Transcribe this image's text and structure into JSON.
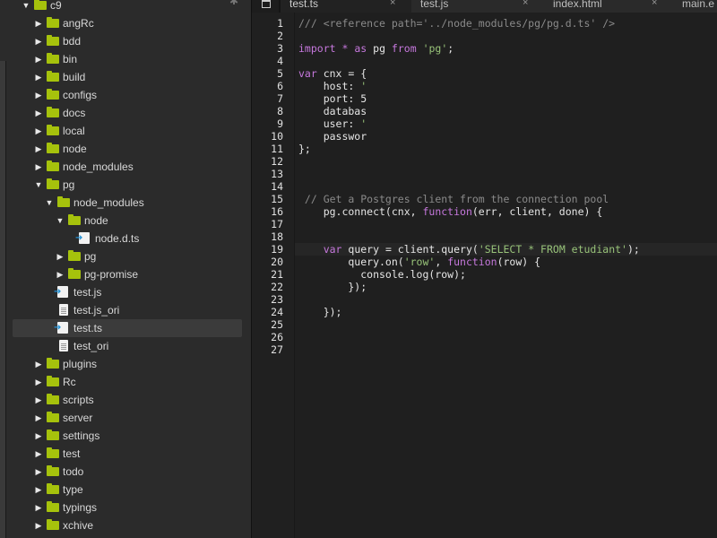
{
  "tree": {
    "root": {
      "label": "c9",
      "icon": "folder-icon"
    },
    "items": [
      {
        "label": "angRc"
      },
      {
        "label": "bdd"
      },
      {
        "label": "bin"
      },
      {
        "label": "build"
      },
      {
        "label": "configs"
      },
      {
        "label": "docs"
      },
      {
        "label": "local"
      },
      {
        "label": "node"
      },
      {
        "label": "node_modules"
      },
      {
        "label": "pg"
      },
      {
        "label": "node_modules"
      },
      {
        "label": "node"
      },
      {
        "label": "node.d.ts"
      },
      {
        "label": "pg"
      },
      {
        "label": "pg-promise"
      },
      {
        "label": "test.js"
      },
      {
        "label": "test.js_ori"
      },
      {
        "label": "test.ts"
      },
      {
        "label": "test_ori"
      },
      {
        "label": "plugins"
      },
      {
        "label": "Rc"
      },
      {
        "label": "scripts"
      },
      {
        "label": "server"
      },
      {
        "label": "settings"
      },
      {
        "label": "test"
      },
      {
        "label": "todo"
      },
      {
        "label": "type"
      },
      {
        "label": "typings"
      },
      {
        "label": "xchive"
      }
    ]
  },
  "tabs": [
    {
      "label": "test.ts",
      "active": true
    },
    {
      "label": "test.js",
      "active": false
    },
    {
      "label": "index.html",
      "active": false
    },
    {
      "label": "main.e",
      "active": false
    }
  ],
  "tab_close_glyph": "×",
  "editor": {
    "line_numbers": [
      "1",
      "2",
      "3",
      "4",
      "5",
      "6",
      "7",
      "8",
      "9",
      "10",
      "11",
      "12",
      "13",
      "14",
      "15",
      "16",
      "17",
      "18",
      "19",
      "20",
      "21",
      "22",
      "23",
      "24",
      "25",
      "26",
      "27"
    ],
    "highlighted_line": "19",
    "lines": [
      {
        "text": "/// <reference path='../node_modules/pg/pg.d.ts' />",
        "kind": "comment"
      },
      {
        "text": "",
        "kind": "plain"
      },
      {
        "text": "import * as pg from 'pg';",
        "kind": "mixed"
      },
      {
        "text": "",
        "kind": "plain"
      },
      {
        "text": "var cnx = {",
        "kind": "mixed"
      },
      {
        "text": "    host: '",
        "kind": "mixed"
      },
      {
        "text": "    port: 5",
        "kind": "plain"
      },
      {
        "text": "    databas",
        "kind": "plain"
      },
      {
        "text": "    user: '",
        "kind": "mixed"
      },
      {
        "text": "    passwor",
        "kind": "plain"
      },
      {
        "text": "};",
        "kind": "plain"
      },
      {
        "text": "",
        "kind": "plain"
      },
      {
        "text": "",
        "kind": "plain"
      },
      {
        "text": "",
        "kind": "plain"
      },
      {
        "text": " // Get a Postgres client from the connection pool",
        "kind": "comment"
      },
      {
        "text": "    pg.connect(cnx, function(err, client, done) {",
        "kind": "mixed"
      },
      {
        "text": "",
        "kind": "plain"
      },
      {
        "text": "",
        "kind": "plain"
      },
      {
        "text": "    var query = client.query('SELECT * FROM etudiant');",
        "kind": "mixed"
      },
      {
        "text": "        query.on('row', function(row) {",
        "kind": "mixed"
      },
      {
        "text": "          console.log(row);",
        "kind": "mixed"
      },
      {
        "text": "        });",
        "kind": "plain"
      },
      {
        "text": "",
        "kind": "plain"
      },
      {
        "text": "    });",
        "kind": "plain"
      },
      {
        "text": "",
        "kind": "plain"
      },
      {
        "text": "",
        "kind": "plain"
      },
      {
        "text": "",
        "kind": "plain"
      }
    ]
  },
  "colors": {
    "folder": "#a6c20c",
    "keyword": "#c678dd",
    "string": "#98c379",
    "comment": "#8a8a8a"
  }
}
